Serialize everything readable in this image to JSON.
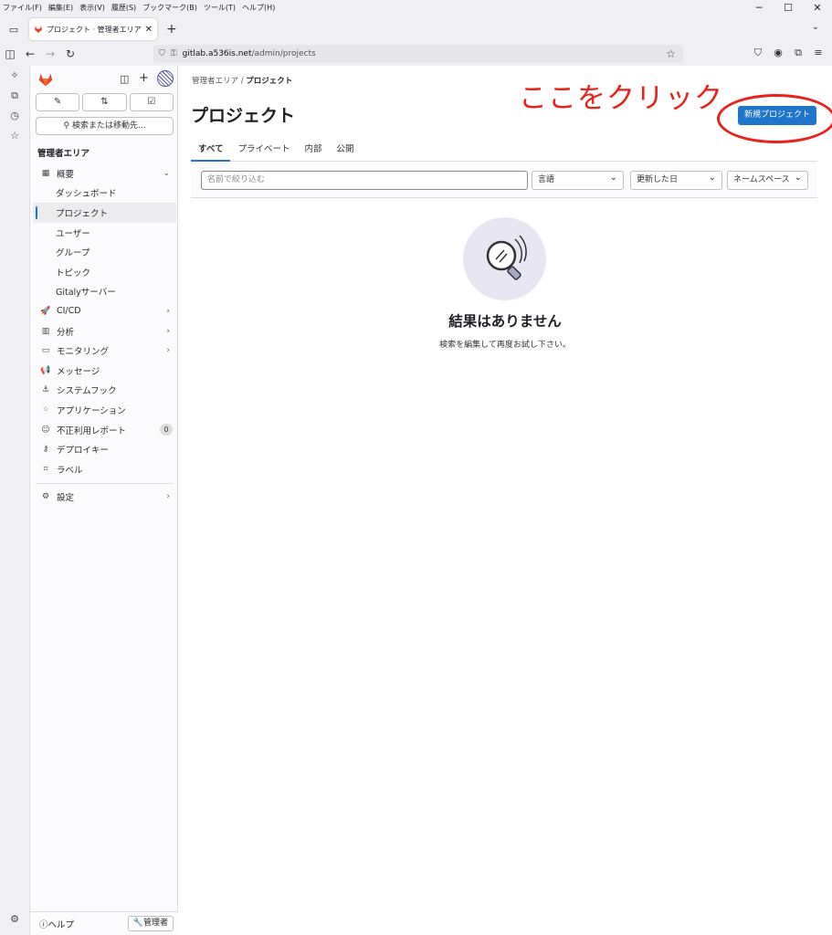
{
  "browser": {
    "menu": [
      "ファイル(F)",
      "編集(E)",
      "表示(V)",
      "履歴(S)",
      "ブックマーク(B)",
      "ツール(T)",
      "ヘルプ(H)"
    ],
    "tab_title": "プロジェクト · 管理者エリア · GitLab",
    "url_host": "gitlab.a536is.net",
    "url_path": "/admin/projects"
  },
  "sidebar": {
    "quick_actions": [
      "✎",
      "⇅",
      "☑"
    ],
    "search_label": "検索または移動先...",
    "section_title": "管理者エリア",
    "items": [
      {
        "label": "概要",
        "icon": "▦",
        "chev": "⌄"
      },
      {
        "label": "ダッシュボード"
      },
      {
        "label": "プロジェクト"
      },
      {
        "label": "ユーザー"
      },
      {
        "label": "グループ"
      },
      {
        "label": "トピック"
      },
      {
        "label": "Gitalyサーバー"
      },
      {
        "label": "CI/CD",
        "icon": "🚀",
        "chev": "›"
      },
      {
        "label": "分析",
        "icon": "▥",
        "chev": "›"
      },
      {
        "label": "モニタリング",
        "icon": "▭",
        "chev": "›"
      },
      {
        "label": "メッセージ",
        "icon": "📢"
      },
      {
        "label": "システムフック",
        "icon": "⚓"
      },
      {
        "label": "アプリケーション",
        "icon": "⁘"
      },
      {
        "label": "不正利用レポート",
        "icon": "☺",
        "count": "0"
      },
      {
        "label": "デプロイキー",
        "icon": "⚷"
      },
      {
        "label": "ラベル",
        "icon": "⌗"
      },
      {
        "label": "設定",
        "icon": "⚙",
        "chev": "›"
      }
    ],
    "help_label": "ヘルプ",
    "admin_label": "管理者"
  },
  "main": {
    "breadcrumb_root": "管理者エリア",
    "breadcrumb_current": "プロジェクト",
    "title": "プロジェクト",
    "new_project_label": "新規プロジェクト",
    "annotation": "ここをクリック",
    "tabs": [
      "すべて",
      "プライベート",
      "内部",
      "公開"
    ],
    "filter_placeholder": "名前で絞り込む",
    "language_label": "言語",
    "sort_label": "更新した日",
    "namespace_label": "ネームスペース",
    "empty_title": "結果はありません",
    "empty_desc": "検索を編集して再度お試し下さい。"
  },
  "colors": {
    "accent": "#1f75cb",
    "annotation": "#e8211b"
  }
}
